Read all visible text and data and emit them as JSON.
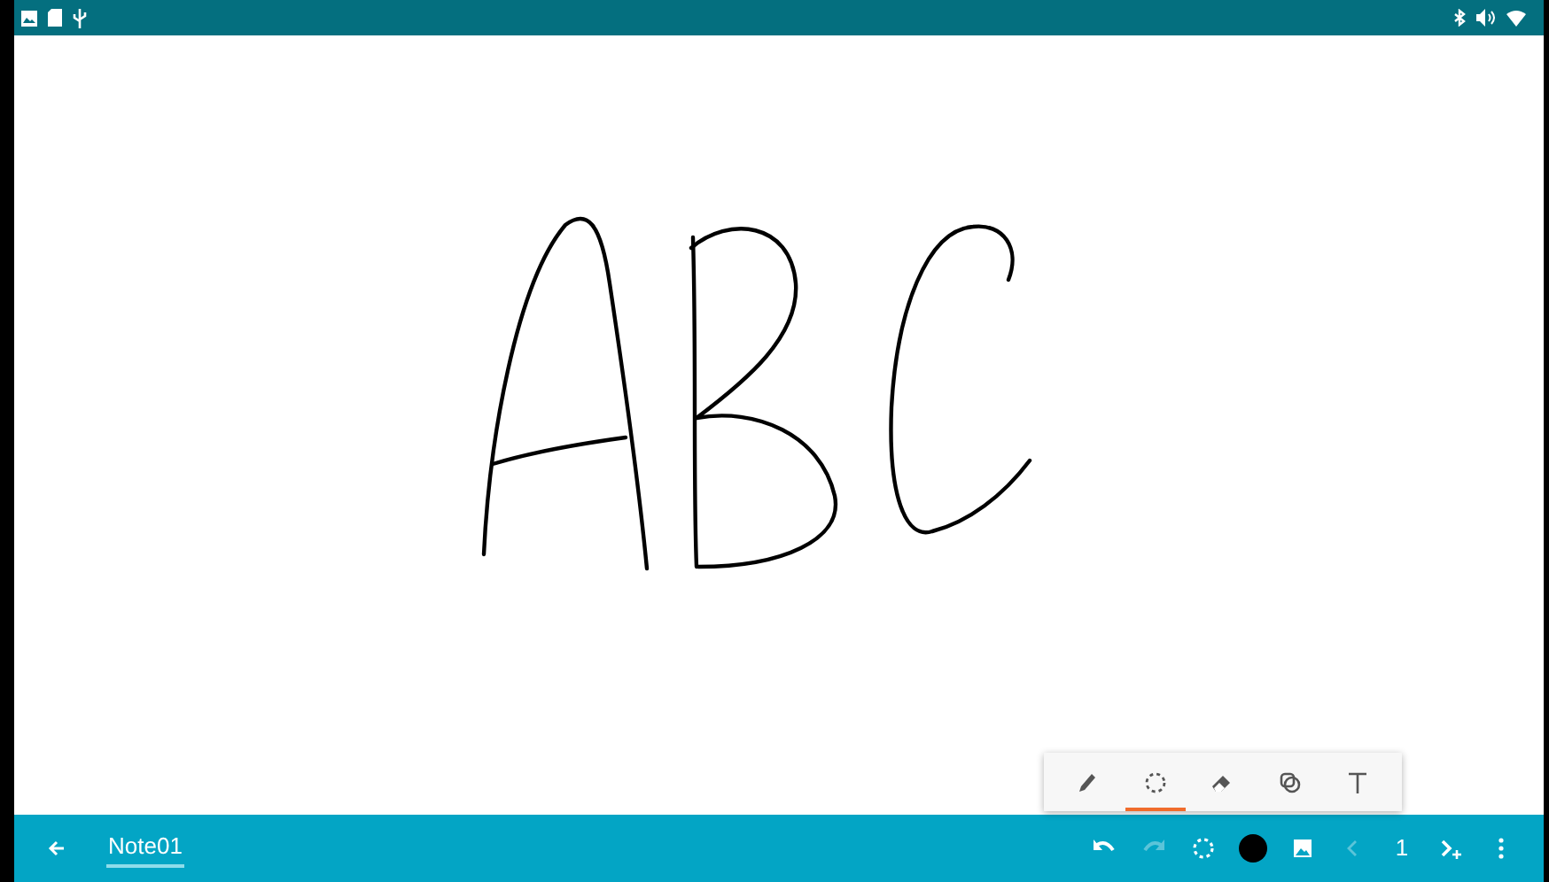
{
  "tool_palette": [
    {
      "kind": "pen",
      "selected": false
    },
    {
      "kind": "lasso",
      "selected": true
    },
    {
      "kind": "eraser",
      "selected": false
    },
    {
      "kind": "shape",
      "selected": false
    },
    {
      "kind": "text",
      "selected": false
    }
  ],
  "bottom_bar": {
    "title": "Note01",
    "actions": [
      {
        "kind": "undo",
        "disabled": false
      },
      {
        "kind": "redo",
        "disabled": true
      },
      {
        "kind": "lasso",
        "disabled": false
      },
      {
        "kind": "color",
        "color": "#000000"
      },
      {
        "kind": "image",
        "disabled": false
      },
      {
        "kind": "prev",
        "disabled": true
      },
      {
        "kind": "page",
        "label": "1"
      },
      {
        "kind": "add-page",
        "disabled": false
      },
      {
        "kind": "more",
        "disabled": false
      }
    ]
  }
}
